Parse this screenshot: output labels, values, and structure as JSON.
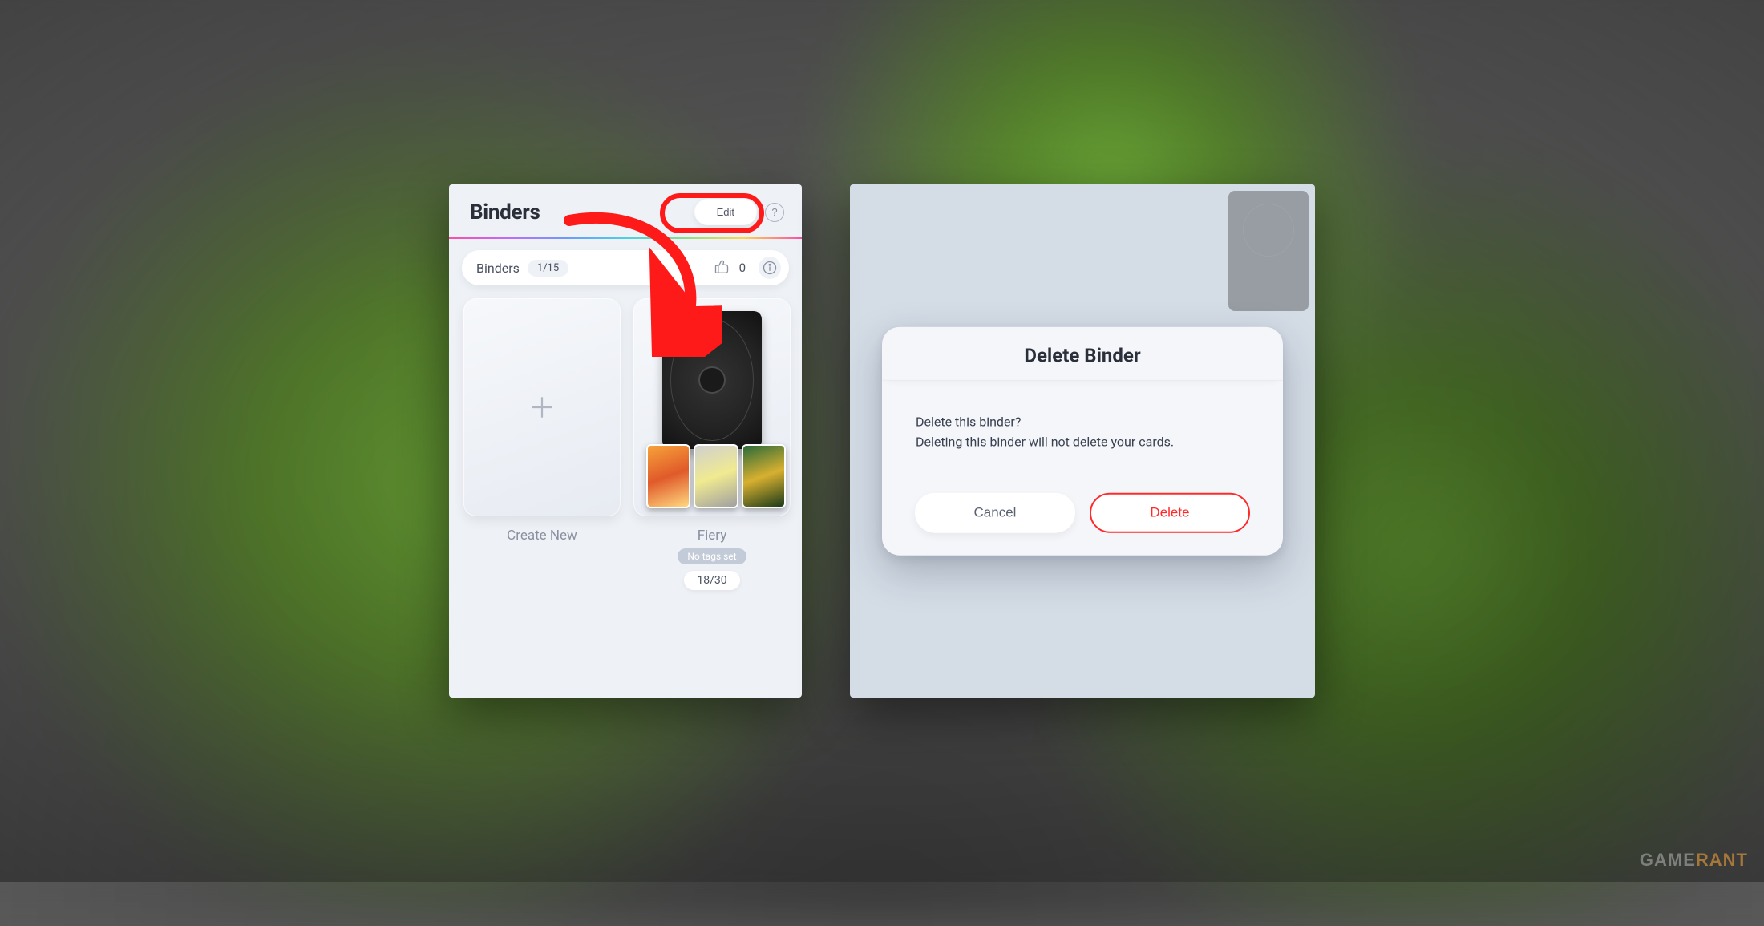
{
  "watermark": {
    "part1": "GAME",
    "part2": "RANT"
  },
  "binders": {
    "title": "Binders",
    "edit_label": "Edit",
    "help_label": "?",
    "stats": {
      "label": "Binders",
      "count": "1/15",
      "likes": "0"
    },
    "tiles": {
      "create_label": "Create New",
      "binder": {
        "name": "Fiery",
        "tag_label": "No tags set",
        "fill": "18/30"
      }
    }
  },
  "dialog": {
    "title": "Delete Binder",
    "line1": "Delete this binder?",
    "line2": "Deleting this binder will not delete your cards.",
    "cancel_label": "Cancel",
    "delete_label": "Delete"
  }
}
